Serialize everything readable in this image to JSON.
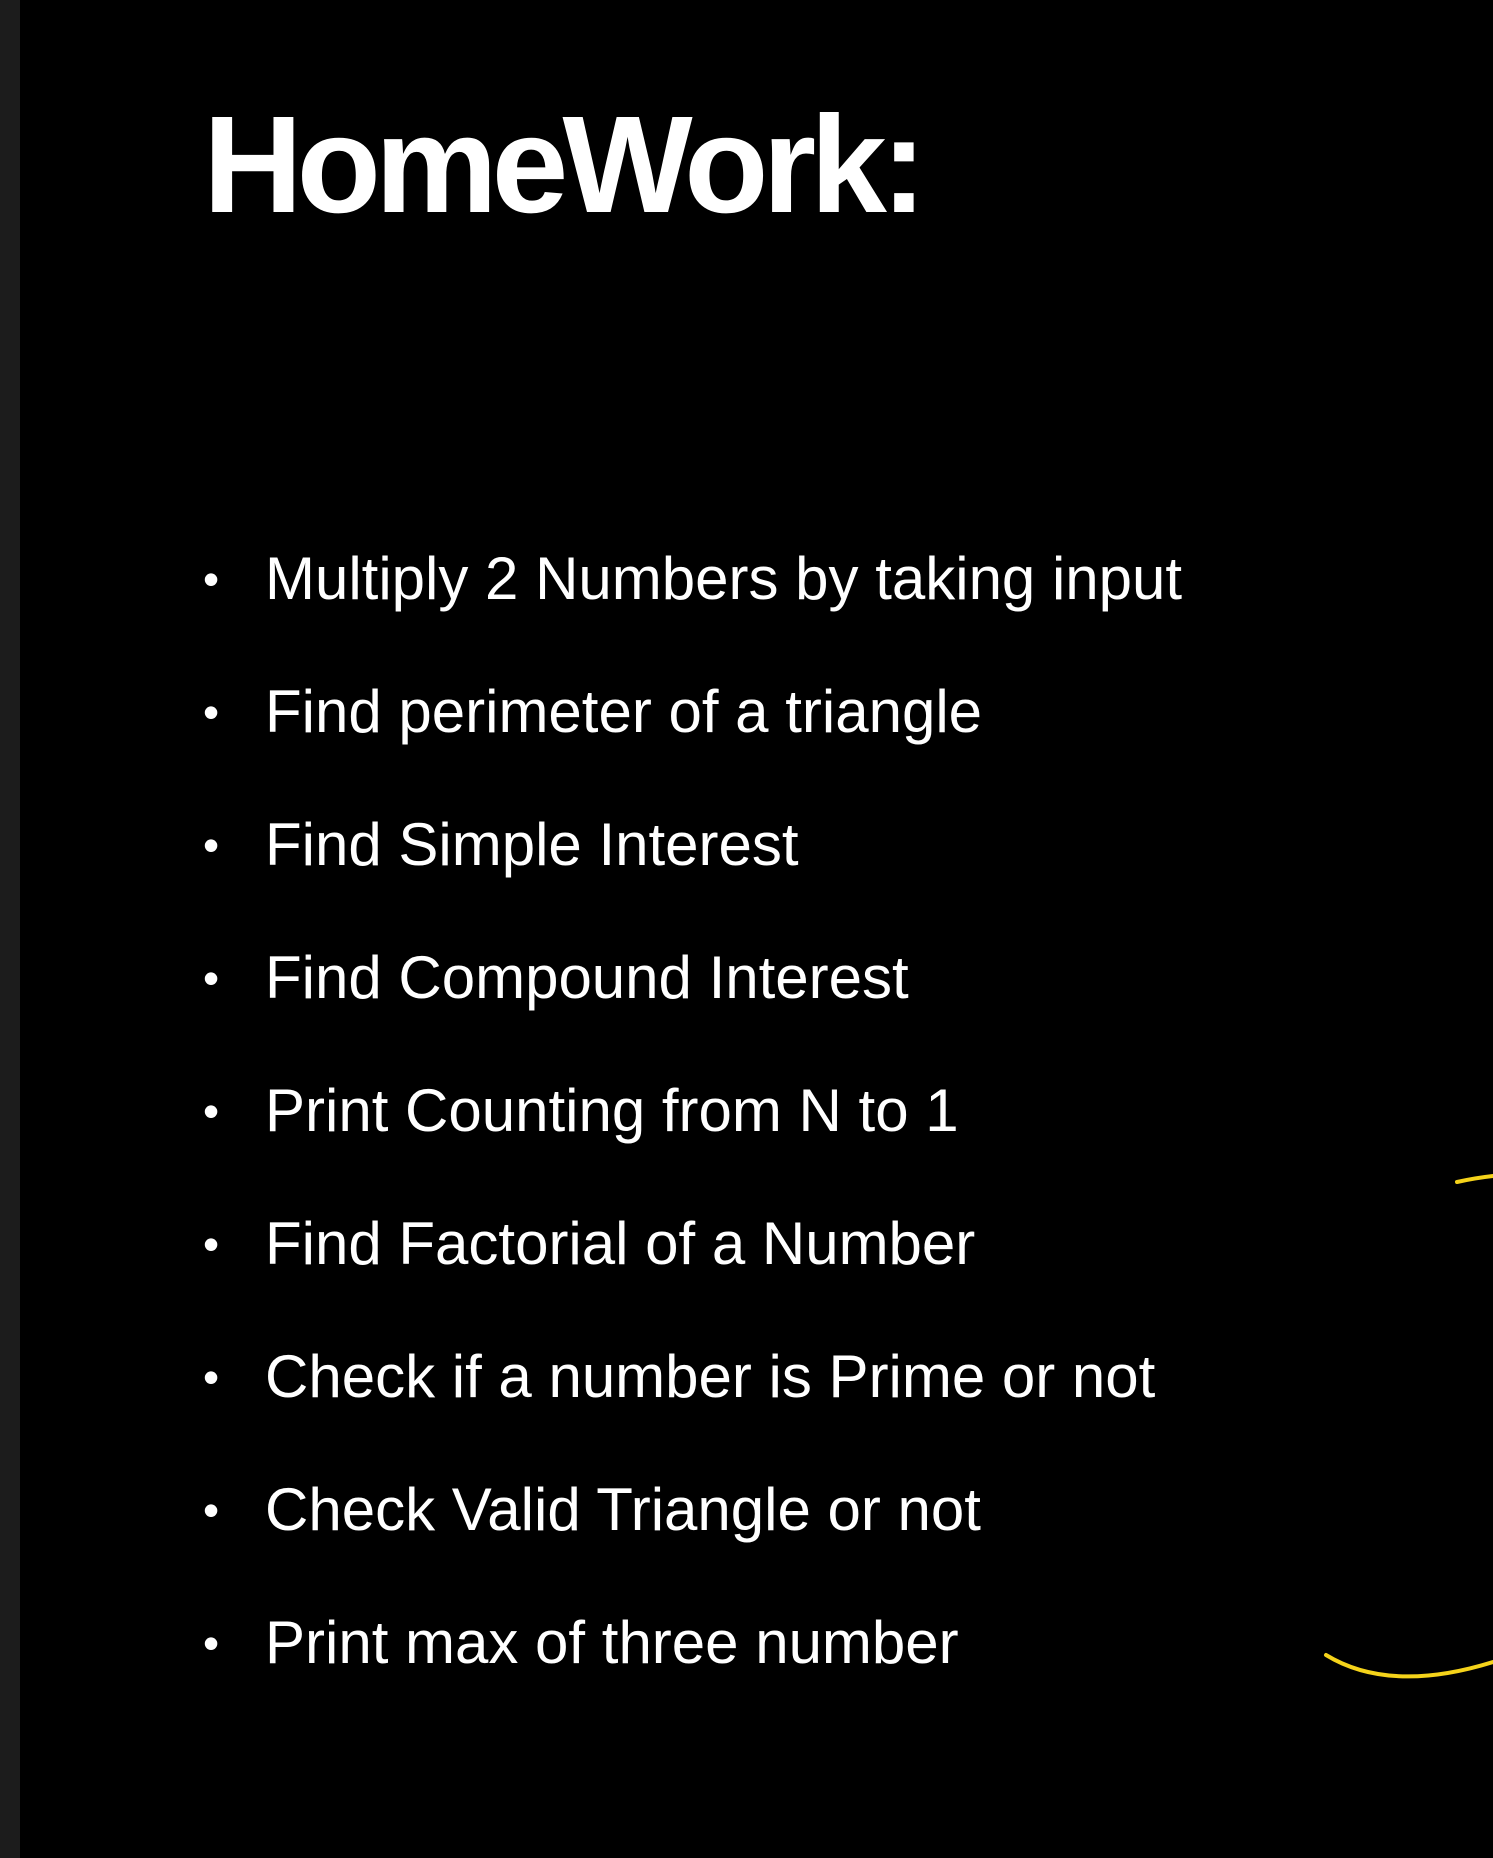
{
  "slide": {
    "title": "HomeWork:",
    "bullet_glyph": "•",
    "tasks": [
      "Multiply 2 Numbers by taking input",
      "Find perimeter of a triangle",
      "Find Simple Interest",
      "Find Compound Interest",
      "Print Counting from N to 1",
      "Find Factorial of a Number",
      "Check if a number is Prime or not",
      "Check Valid Triangle or not",
      "Print max of three number"
    ]
  },
  "colors": {
    "background": "#000000",
    "text": "#ffffff",
    "annotation_ink": "#f5d31a",
    "left_strip": "#1c1c1c"
  }
}
